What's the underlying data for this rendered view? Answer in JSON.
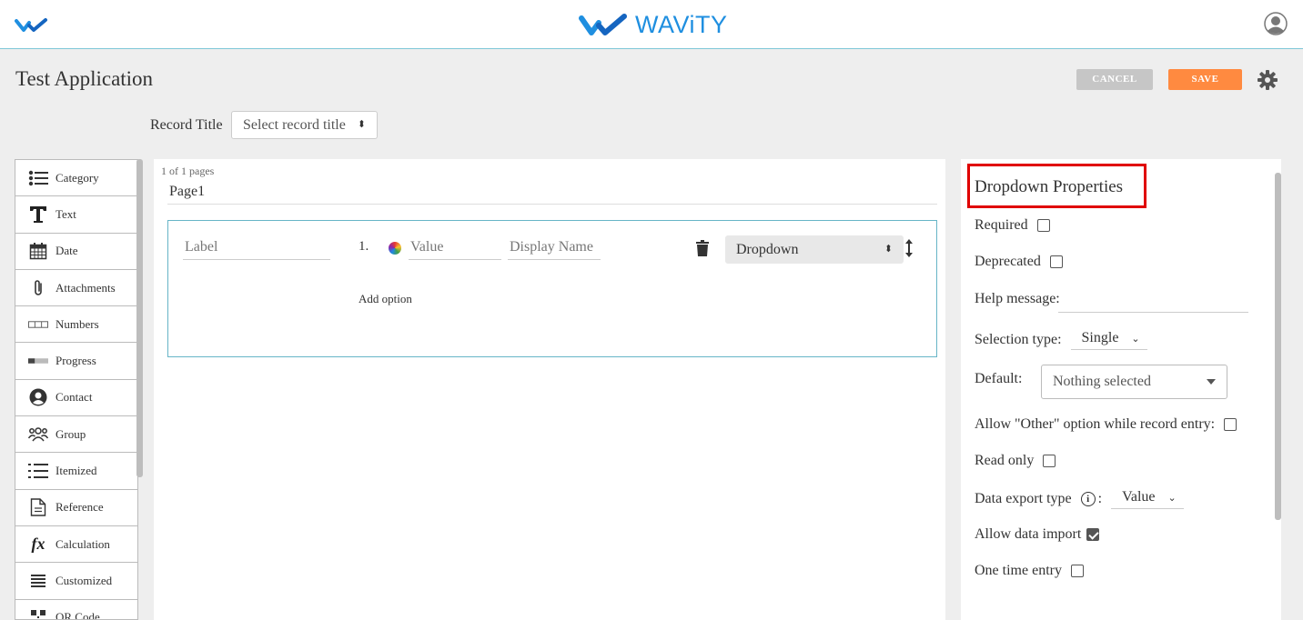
{
  "brand": {
    "name": "WAViTY"
  },
  "header": {
    "app_title": "Test Application",
    "cancel_label": "CANCEL",
    "save_label": "SAVE"
  },
  "record_title": {
    "label": "Record Title",
    "select_value": "Select record title"
  },
  "palette": {
    "items": [
      {
        "label": "Category",
        "icon": "list-icon"
      },
      {
        "label": "Text",
        "icon": "text-icon"
      },
      {
        "label": "Date",
        "icon": "calendar-icon"
      },
      {
        "label": "Attachments",
        "icon": "paperclip-icon"
      },
      {
        "label": "Numbers",
        "icon": "numbers-icon"
      },
      {
        "label": "Progress",
        "icon": "progress-icon"
      },
      {
        "label": "Contact",
        "icon": "contact-icon"
      },
      {
        "label": "Group",
        "icon": "group-icon"
      },
      {
        "label": "Itemized",
        "icon": "itemized-icon"
      },
      {
        "label": "Reference",
        "icon": "document-icon"
      },
      {
        "label": "Calculation",
        "icon": "fx-icon"
      },
      {
        "label": "Customized",
        "icon": "lines-icon"
      },
      {
        "label": "QR Code",
        "icon": "qr-code-icon"
      }
    ]
  },
  "canvas": {
    "pages_label": "1 of 1 pages",
    "page_name": "Page1",
    "field": {
      "label_placeholder": "Label",
      "option_number": "1.",
      "value_placeholder": "Value",
      "display_name_placeholder": "Display Name",
      "add_option": "Add option",
      "type_value": "Dropdown"
    }
  },
  "properties": {
    "title": "Dropdown Properties",
    "required_label": "Required",
    "deprecated_label": "Deprecated",
    "help_message_label": "Help message:",
    "selection_type_label": "Selection type:",
    "selection_type_value": "Single",
    "default_label": "Default:",
    "default_value": "Nothing selected",
    "allow_other_label": "Allow \"Other\" option while record entry:",
    "read_only_label": "Read only",
    "data_export_label": "Data export type",
    "data_export_colon": ":",
    "data_export_value": "Value",
    "allow_import_label": "Allow data import",
    "one_time_entry_label": "One time entry",
    "checked": {
      "required": false,
      "deprecated": false,
      "allow_other": false,
      "read_only": false,
      "allow_import": true,
      "one_time_entry": false
    },
    "accent_color": "#e00000"
  },
  "colors": {
    "save": "#ff8a40",
    "cancel": "#c6c6c6",
    "brand": "#1f8fe0",
    "field_border": "#67b5c7"
  }
}
